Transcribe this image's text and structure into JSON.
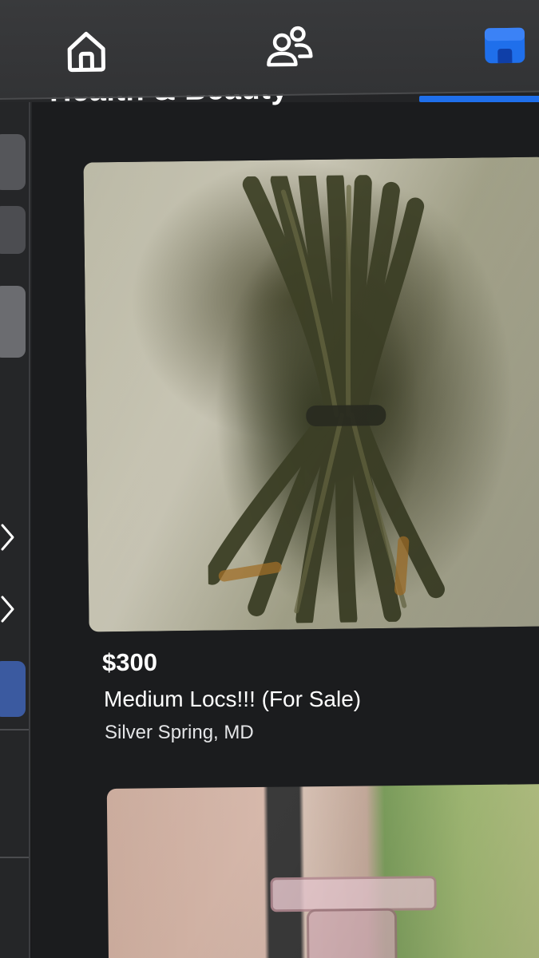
{
  "nav": {
    "tabs": [
      {
        "name": "home",
        "icon": "home-icon",
        "active": false
      },
      {
        "name": "friends",
        "icon": "friends-icon",
        "active": false
      },
      {
        "name": "marketplace",
        "icon": "marketplace-store-icon",
        "active": true
      }
    ],
    "accent_color": "#1f6feb"
  },
  "category": {
    "title": "Health & Beauty"
  },
  "listings": [
    {
      "price": "$300",
      "title": "Medium Locs!!! (For Sale)",
      "location": "Silver Spring, MD",
      "image": "bundle-of-locs-photo"
    },
    {
      "price": "",
      "title": "",
      "location": "",
      "image": "candle-holder-window-photo"
    }
  ]
}
